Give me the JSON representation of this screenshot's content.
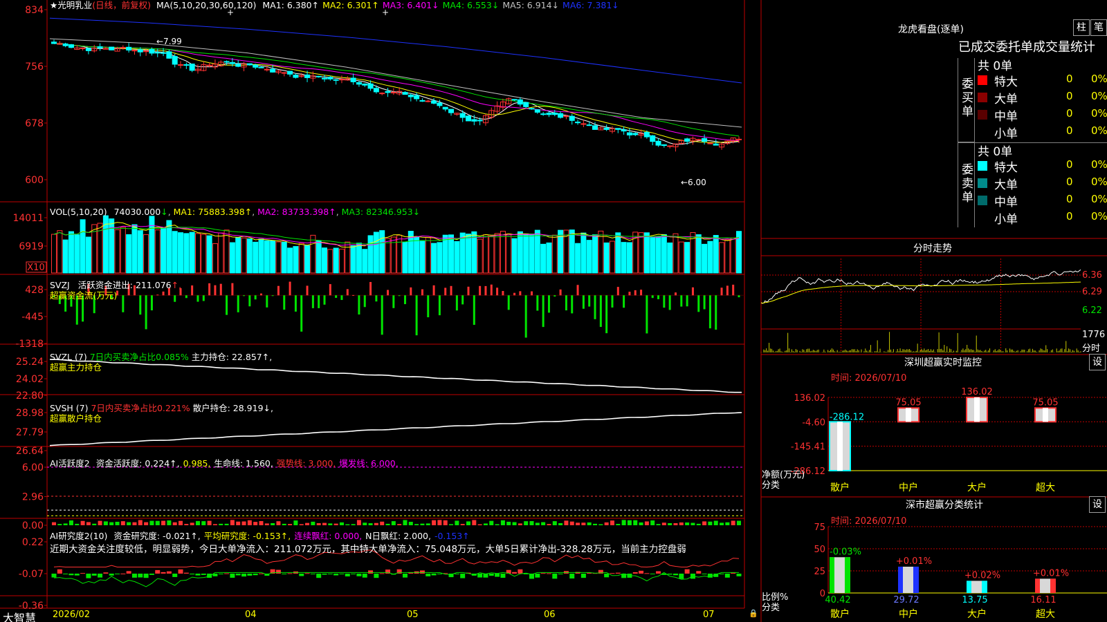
{
  "colors": {
    "up": "#ff3232",
    "down": "#00ffff",
    "ma1": "#ffffff",
    "ma2": "#ffff00",
    "ma3": "#ff00ff",
    "ma4": "#00e400",
    "ma5": "#c0c0c0",
    "ma6": "#1e32ff",
    "frame": "#c00000",
    "green": "#00e400",
    "yellow": "#ffff00",
    "white": "#ffffff",
    "magenta": "#ff00ff"
  },
  "app": {
    "logo": "大智慧"
  },
  "main": {
    "star": "★",
    "stock": "光明乳业",
    "period": "(日线，前复权)",
    "ma_params": "MA(5,10,20,30,60,120)",
    "ma_items": [
      {
        "label": "MA1:",
        "value": "6.380",
        "arrow": "↑",
        "color": "#ffffff"
      },
      {
        "label": "MA2:",
        "value": "6.301",
        "arrow": "↑",
        "color": "#ffff00"
      },
      {
        "label": "MA3:",
        "value": "6.401",
        "arrow": "↓",
        "color": "#ff00ff"
      },
      {
        "label": "MA4:",
        "value": "6.553",
        "arrow": "↓",
        "color": "#00e400"
      },
      {
        "label": "MA5:",
        "value": "6.914",
        "arrow": "↓",
        "color": "#c0c0c0"
      },
      {
        "label": "MA6:",
        "value": "7.381",
        "arrow": "↓",
        "color": "#1e32ff"
      }
    ],
    "y_ticks": [
      "834",
      "756",
      "678",
      "600"
    ],
    "high_label": "7.99",
    "low_label": "6.00",
    "dates": [
      "2026/02",
      "04",
      "05",
      "06",
      "07"
    ]
  },
  "vol": {
    "label": "VOL(5,10,20)",
    "value": "74030.000",
    "arrow": "↓",
    "ma1": "MA1: 75883.398↑",
    "ma2": "MA2: 83733.398↑",
    "ma3": "MA3: 82346.953↓",
    "y_ticks": [
      "14011",
      "6919"
    ],
    "unit": "X10"
  },
  "svzj": {
    "label": "SVZJ",
    "title": "活跃资金进出:",
    "value": "211.076",
    "arrow": "↑,",
    "sub": "超赢资金流(万元)",
    "y_ticks": [
      "428",
      "-445",
      "-1318"
    ]
  },
  "svzl": {
    "label": "SVZL (7)",
    "ratio": "7日内买卖净占比0.085%",
    "hold": "主力持仓: 22.857↑,",
    "sub": "超赢主力持仓",
    "y_ticks": [
      "25.24",
      "24.02",
      "22.80"
    ]
  },
  "svsh": {
    "label": "SVSH (7)",
    "ratio": "7日内买卖净占比0.221%",
    "hold": "散户持仓: 28.919↓,",
    "sub": "超赢散户持仓",
    "y_ticks": [
      "28.98",
      "27.79",
      "26.64"
    ]
  },
  "ai2": {
    "label": "AI活跃度2",
    "items": [
      {
        "text": "资金活跃度: 0.224↑,",
        "color": "#ffffff"
      },
      {
        "text": "0.985,",
        "color": "#ffff00"
      },
      {
        "text": "生命线: 1.560,",
        "color": "#ffffff"
      },
      {
        "text": "强势线: 3.000,",
        "color": "#ff3232"
      },
      {
        "text": "爆发线: 6.000,",
        "color": "#ff00ff"
      }
    ],
    "y_ticks": [
      "6.00",
      "2.96",
      "0.00"
    ]
  },
  "research": {
    "label": "AI研究度2(10)",
    "items": [
      {
        "text": "资金研究度: -0.021↑,",
        "color": "#ffffff"
      },
      {
        "text": "平均研究度: -0.153↑,",
        "color": "#ffff00"
      },
      {
        "text": "连续飘红: 0.000,",
        "color": "#ff00ff"
      },
      {
        "text": "N日飘红: 2.000,",
        "color": "#ffffff"
      },
      {
        "text": "-0.153↑",
        "color": "#1e32ff"
      }
    ],
    "note": "近期大资金关注度较低，明显弱势，今日大单净流入：211.072万元，其中特大单净流入：75.048万元，大单5日累计净出-328.28万元，当前主力控盘弱",
    "y_ticks": [
      "0.22",
      "-0.07",
      "-0.36"
    ]
  },
  "lhb": {
    "title": "龙虎看盘(逐单)",
    "btn1": "柱",
    "btn2": "笔",
    "subtitle": "已成交委托单成交量统计",
    "buy_label": "委买单",
    "sell_label": "委卖单",
    "buy_total": "共 0单",
    "sell_total": "共 0单",
    "buy_rows": [
      {
        "label": "特大",
        "count": "0",
        "pct": "0%",
        "color": "#ff0000"
      },
      {
        "label": "大单",
        "count": "0",
        "pct": "0%",
        "color": "#8b0000"
      },
      {
        "label": "中单",
        "count": "0",
        "pct": "0%",
        "color": "#5a0000"
      },
      {
        "label": "小单",
        "count": "0",
        "pct": "0%",
        "color": "#000000"
      }
    ],
    "sell_rows": [
      {
        "label": "特大",
        "count": "0",
        "pct": "0%",
        "color": "#00ffff"
      },
      {
        "label": "大单",
        "count": "0",
        "pct": "0%",
        "color": "#008b8b"
      },
      {
        "label": "中单",
        "count": "0",
        "pct": "0%",
        "color": "#006b6b"
      },
      {
        "label": "小单",
        "count": "0",
        "pct": "0%",
        "color": "#000000"
      }
    ]
  },
  "intraday": {
    "title": "分时走势",
    "y_ticks": [
      "6.36",
      "6.29",
      "6.22"
    ],
    "vol_tick": "1776",
    "vol_label": "分时"
  },
  "monitor": {
    "title": "深圳超赢实时监控",
    "btn": "设",
    "time": "时间: 2026/07/10",
    "y_ticks": [
      "136.02",
      "-4.60",
      "-145.41",
      "-286.12"
    ],
    "ylabel": "净额(万元)",
    "xlabel": "分类",
    "cats": [
      "散户",
      "中户",
      "大户",
      "超大"
    ],
    "values": [
      -286.12,
      75.05,
      136.02,
      75.05
    ],
    "value_labels": [
      "-286.12",
      "75.05",
      "136.02",
      "75.05"
    ]
  },
  "stat": {
    "title": "深市超赢分类统计",
    "btn": "设",
    "time": "时间: 2026/07/10",
    "y_ticks": [
      "75",
      "50",
      "25",
      "0"
    ],
    "ylabel": "比例%",
    "xlabel": "分类",
    "cats": [
      "散户",
      "中户",
      "大户",
      "超大"
    ],
    "values": [
      40.42,
      29.72,
      13.75,
      16.11
    ],
    "value_labels": [
      "40.42",
      "29.72",
      "13.75",
      "16.11"
    ],
    "pct_labels": [
      "-0.03%",
      "+0.01%",
      "+0.02%",
      "+0.01%"
    ],
    "pct_colors": [
      "#00e400",
      "#ff3232",
      "#ff3232",
      "#ff3232"
    ],
    "bar_colors": [
      "#00e400",
      "#1e32ff",
      "#00ffff",
      "#ff3232"
    ]
  },
  "chart_data": [
    {
      "type": "candlestick",
      "title": "光明乳业 (日线，前复权)",
      "ylim": [
        600,
        834
      ],
      "y_ticks": [
        "834",
        "756",
        "678",
        "600"
      ],
      "x_ticks": [
        "2026/02",
        "04",
        "05",
        "06",
        "07"
      ],
      "high_mark": "7.99",
      "low_mark": "6.00",
      "series": [
        {
          "name": "MA1",
          "value": 6.38
        },
        {
          "name": "MA2",
          "value": 6.301
        },
        {
          "name": "MA3",
          "value": 6.401
        },
        {
          "name": "MA4",
          "value": 6.553
        },
        {
          "name": "MA5",
          "value": 6.914
        },
        {
          "name": "MA6",
          "value": 7.381
        }
      ]
    },
    {
      "type": "bar",
      "title": "VOL(5,10,20)",
      "last": 74030.0,
      "y_ticks": [
        "14011",
        "6919"
      ],
      "series": [
        {
          "name": "MA1",
          "value": 75883.398
        },
        {
          "name": "MA2",
          "value": 83733.398
        },
        {
          "name": "MA3",
          "value": 82346.953
        }
      ]
    },
    {
      "type": "bar",
      "title": "超赢资金流(万元)",
      "ylim": [
        -1318,
        428
      ],
      "last": 211.076
    },
    {
      "type": "line",
      "title": "超赢主力持仓",
      "ylim": [
        22.8,
        25.24
      ],
      "last": 22.857
    },
    {
      "type": "line",
      "title": "超赢散户持仓",
      "ylim": [
        26.64,
        28.98
      ],
      "last": 28.919
    },
    {
      "type": "bar",
      "title": "AI活跃度2",
      "ylim": [
        0,
        6
      ],
      "series": [
        {
          "name": "资金活跃度",
          "value": 0.224
        },
        {
          "name": "生命线",
          "value": 1.56
        },
        {
          "name": "强势线",
          "value": 3.0
        },
        {
          "name": "爆发线",
          "value": 6.0
        }
      ]
    },
    {
      "type": "bar",
      "title": "AI研究度2(10)",
      "ylim": [
        -0.36,
        0.22
      ],
      "series": [
        {
          "name": "资金研究度",
          "value": -0.021
        },
        {
          "name": "平均研究度",
          "value": -0.153
        }
      ]
    },
    {
      "type": "bar",
      "title": "深圳超赢实时监控",
      "categories": [
        "散户",
        "中户",
        "大户",
        "超大"
      ],
      "values": [
        -286.12,
        75.05,
        136.02,
        75.05
      ],
      "ylim": [
        -286.12,
        136.02
      ],
      "ylabel": "净额(万元)",
      "xlabel": "分类"
    },
    {
      "type": "bar",
      "title": "深市超赢分类统计",
      "categories": [
        "散户",
        "中户",
        "大户",
        "超大"
      ],
      "values": [
        40.42,
        29.72,
        13.75,
        16.11
      ],
      "ylim": [
        0,
        75
      ],
      "ylabel": "比例%",
      "xlabel": "分类"
    }
  ]
}
